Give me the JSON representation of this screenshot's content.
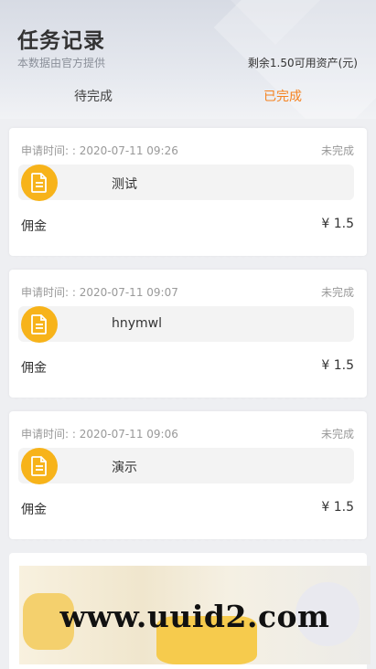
{
  "header": {
    "title": "任务记录",
    "subtitle": "本数据由官方提供",
    "balance_text": "剩余1.50可用资产(元)"
  },
  "tabs": [
    {
      "label": "待完成",
      "active": false
    },
    {
      "label": "已完成",
      "active": true
    }
  ],
  "tasks": [
    {
      "time_label": "申请时间: : 2020-07-11 09:26",
      "status": "未完成",
      "name": "测试",
      "fee_label": "佣金",
      "fee_value": "¥ 1.5"
    },
    {
      "time_label": "申请时间: : 2020-07-11 09:07",
      "status": "未完成",
      "name": "hnymwl",
      "fee_label": "佣金",
      "fee_value": "¥ 1.5"
    },
    {
      "time_label": "申请时间: : 2020-07-11 09:06",
      "status": "未完成",
      "name": "演示",
      "fee_label": "佣金",
      "fee_value": "¥ 1.5"
    }
  ],
  "icons": {
    "task": "document-icon"
  },
  "colors": {
    "accent": "#f5821f",
    "icon_bg": "#f7b31a"
  },
  "watermark": "www.uuid2.com"
}
